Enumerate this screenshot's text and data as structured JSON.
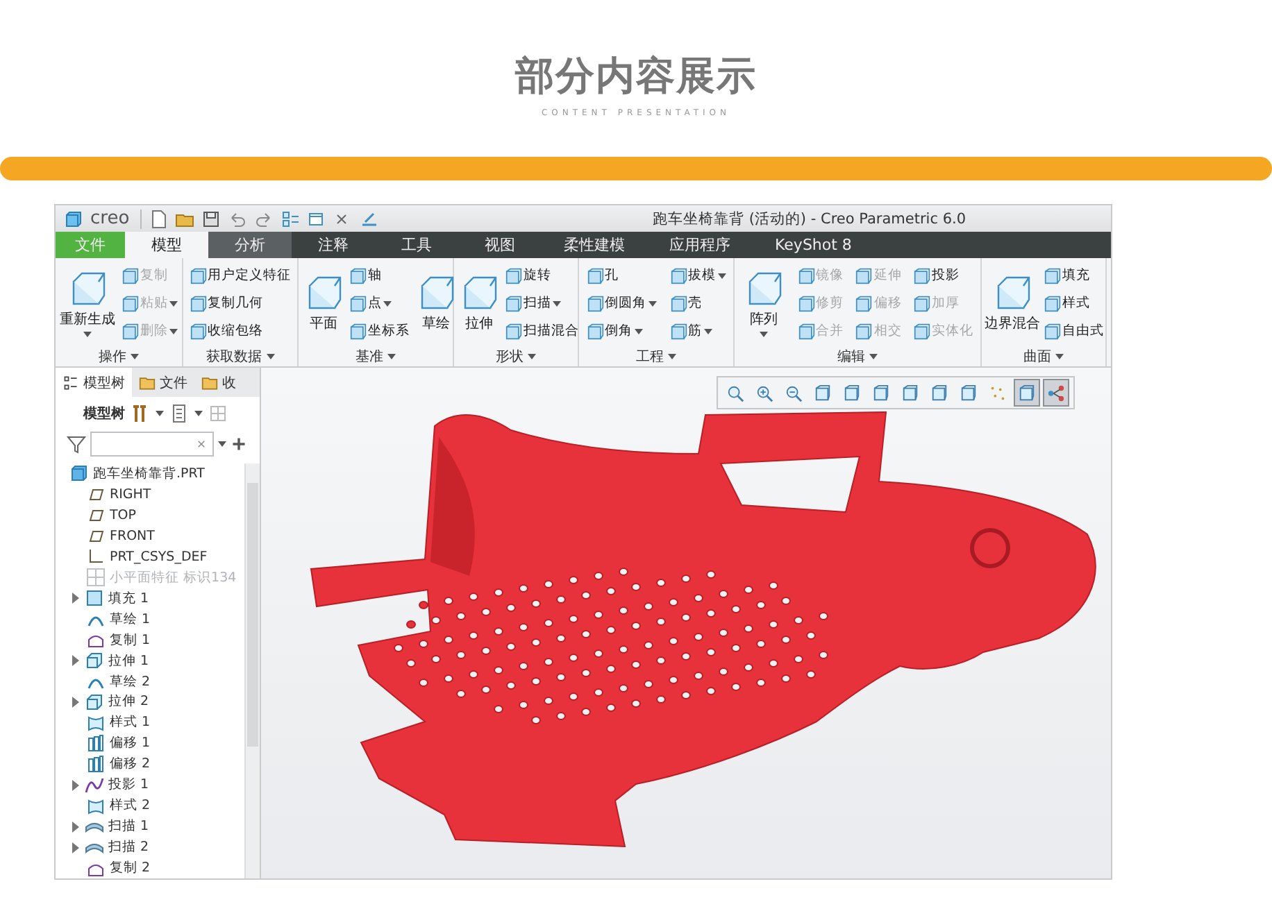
{
  "heading": {
    "title": "部分内容展示",
    "subtitle": "CONTENT PRESENTATION"
  },
  "window": {
    "logo": "creo",
    "title": "跑车坐椅靠背 (活动的) - Creo Parametric 6.0"
  },
  "tabs": [
    {
      "label": "文件",
      "kind": "file",
      "selected": false
    },
    {
      "label": "模型",
      "kind": "tab",
      "selected": true
    },
    {
      "label": "分析",
      "kind": "tab",
      "selected": false,
      "hovered": true
    },
    {
      "label": "注释",
      "kind": "tab",
      "selected": false,
      "hovered": false
    },
    {
      "label": "工具",
      "kind": "tab",
      "selected": false,
      "hovered": false
    },
    {
      "label": "视图",
      "kind": "tab",
      "selected": false,
      "hovered": false
    },
    {
      "label": "柔性建模",
      "kind": "tab",
      "selected": false,
      "hovered": false
    },
    {
      "label": "应用程序",
      "kind": "tab",
      "selected": false,
      "hovered": false
    },
    {
      "label": "KeyShot 8",
      "kind": "tab",
      "selected": false,
      "hovered": false
    }
  ],
  "ribbon": [
    {
      "label": "操作",
      "columns": [
        [
          {
            "label": "重新生成",
            "kind": "large",
            "dropdown": true,
            "disabled": false
          }
        ],
        [
          {
            "label": "复制",
            "kind": "small",
            "dropdown": false,
            "disabled": true
          },
          {
            "label": "粘贴",
            "kind": "small",
            "dropdown": true,
            "disabled": true
          },
          {
            "label": "删除",
            "kind": "small",
            "dropdown": true,
            "disabled": true
          }
        ]
      ]
    },
    {
      "label": "获取数据",
      "columns": [
        [
          {
            "label": "用户定义特征",
            "kind": "small",
            "dropdown": false,
            "disabled": false
          },
          {
            "label": "复制几何",
            "kind": "small",
            "dropdown": false,
            "disabled": false
          },
          {
            "label": "收缩包络",
            "kind": "small",
            "dropdown": false,
            "disabled": false
          }
        ]
      ]
    },
    {
      "label": "基准",
      "columns": [
        [
          {
            "label": "平面",
            "kind": "large",
            "dropdown": false,
            "disabled": false
          }
        ],
        [
          {
            "label": "轴",
            "kind": "small",
            "dropdown": false,
            "disabled": false
          },
          {
            "label": "点",
            "kind": "small",
            "dropdown": true,
            "disabled": false
          },
          {
            "label": "坐标系",
            "kind": "small",
            "dropdown": false,
            "disabled": false
          }
        ],
        [
          {
            "label": "草绘",
            "kind": "large",
            "dropdown": false,
            "disabled": false
          }
        ]
      ]
    },
    {
      "label": "形状",
      "columns": [
        [
          {
            "label": "拉伸",
            "kind": "large",
            "dropdown": false,
            "disabled": false
          }
        ],
        [
          {
            "label": "旋转",
            "kind": "small",
            "dropdown": false,
            "disabled": false
          },
          {
            "label": "扫描",
            "kind": "small",
            "dropdown": true,
            "disabled": false
          },
          {
            "label": "扫描混合",
            "kind": "small",
            "dropdown": false,
            "disabled": false
          }
        ]
      ]
    },
    {
      "label": "工程",
      "columns": [
        [
          {
            "label": "孔",
            "kind": "small",
            "dropdown": false,
            "disabled": false
          },
          {
            "label": "倒圆角",
            "kind": "small",
            "dropdown": true,
            "disabled": false
          },
          {
            "label": "倒角",
            "kind": "small",
            "dropdown": true,
            "disabled": false
          }
        ],
        [
          {
            "label": "拔模",
            "kind": "small",
            "dropdown": true,
            "disabled": false
          },
          {
            "label": "壳",
            "kind": "small",
            "dropdown": false,
            "disabled": false
          },
          {
            "label": "筋",
            "kind": "small",
            "dropdown": true,
            "disabled": false
          }
        ]
      ]
    },
    {
      "label": "编辑",
      "columns": [
        [
          {
            "label": "阵列",
            "kind": "large",
            "dropdown": true,
            "disabled": false
          }
        ],
        [
          {
            "label": "镜像",
            "kind": "small",
            "dropdown": false,
            "disabled": true
          },
          {
            "label": "修剪",
            "kind": "small",
            "dropdown": false,
            "disabled": true
          },
          {
            "label": "合并",
            "kind": "small",
            "dropdown": false,
            "disabled": true
          }
        ],
        [
          {
            "label": "延伸",
            "kind": "small",
            "dropdown": false,
            "disabled": true
          },
          {
            "label": "偏移",
            "kind": "small",
            "dropdown": false,
            "disabled": true
          },
          {
            "label": "相交",
            "kind": "small",
            "dropdown": false,
            "disabled": true
          }
        ],
        [
          {
            "label": "投影",
            "kind": "small",
            "dropdown": false,
            "disabled": false
          },
          {
            "label": "加厚",
            "kind": "small",
            "dropdown": false,
            "disabled": true
          },
          {
            "label": "实体化",
            "kind": "small",
            "dropdown": false,
            "disabled": true
          }
        ]
      ]
    },
    {
      "label": "曲面",
      "columns": [
        [
          {
            "label": "边界混合",
            "kind": "large",
            "dropdown": false,
            "disabled": false
          }
        ],
        [
          {
            "label": "填充",
            "kind": "small",
            "dropdown": false,
            "disabled": false
          },
          {
            "label": "样式",
            "kind": "small",
            "dropdown": false,
            "disabled": false
          },
          {
            "label": "自由式",
            "kind": "small",
            "dropdown": false,
            "disabled": false
          }
        ]
      ]
    }
  ],
  "panel_tabs": [
    {
      "label": "模型树",
      "selected": true
    },
    {
      "label": "文件",
      "selected": false
    },
    {
      "label": "收",
      "selected": false
    }
  ],
  "panel_toolbar": {
    "label": "模型树"
  },
  "view_toolbar": [
    {
      "selected": false
    },
    {
      "selected": false
    },
    {
      "selected": false
    },
    {
      "selected": false
    },
    {
      "selected": false
    },
    {
      "selected": false
    },
    {
      "selected": false
    },
    {
      "selected": false
    },
    {
      "selected": false
    },
    {
      "selected": false
    },
    {
      "selected": true
    },
    {
      "selected": true
    }
  ],
  "tree": [
    {
      "label": "跑车坐椅靠背.PRT",
      "kind": "part",
      "expandable": false,
      "disabled": false
    },
    {
      "label": "RIGHT",
      "kind": "plane",
      "expandable": false,
      "disabled": false
    },
    {
      "label": "TOP",
      "kind": "plane",
      "expandable": false,
      "disabled": false
    },
    {
      "label": "FRONT",
      "kind": "plane",
      "expandable": false,
      "disabled": false
    },
    {
      "label": "PRT_CSYS_DEF",
      "kind": "csys",
      "expandable": false,
      "disabled": false
    },
    {
      "label": "小平面特征 标识134",
      "kind": "facet",
      "expandable": false,
      "disabled": true
    },
    {
      "label": "填充 1",
      "kind": "fill",
      "expandable": true,
      "disabled": false
    },
    {
      "label": "草绘 1",
      "kind": "sketch",
      "expandable": false,
      "disabled": false
    },
    {
      "label": "复制 1",
      "kind": "copy",
      "expandable": false,
      "disabled": false
    },
    {
      "label": "拉伸 1",
      "kind": "extrude",
      "expandable": true,
      "disabled": false
    },
    {
      "label": "草绘 2",
      "kind": "sketch",
      "expandable": false,
      "disabled": false
    },
    {
      "label": "拉伸 2",
      "kind": "extrude",
      "expandable": true,
      "disabled": false
    },
    {
      "label": "样式 1",
      "kind": "style",
      "expandable": false,
      "disabled": false
    },
    {
      "label": "偏移 1",
      "kind": "offset",
      "expandable": false,
      "disabled": false
    },
    {
      "label": "偏移 2",
      "kind": "offset",
      "expandable": false,
      "disabled": false
    },
    {
      "label": "投影 1",
      "kind": "project",
      "expandable": true,
      "disabled": false
    },
    {
      "label": "样式 2",
      "kind": "style",
      "expandable": false,
      "disabled": false
    },
    {
      "label": "扫描 1",
      "kind": "sweep",
      "expandable": true,
      "disabled": false
    },
    {
      "label": "扫描 2",
      "kind": "sweep",
      "expandable": true,
      "disabled": false
    },
    {
      "label": "复制 2",
      "kind": "copy",
      "expandable": false,
      "disabled": false
    }
  ]
}
